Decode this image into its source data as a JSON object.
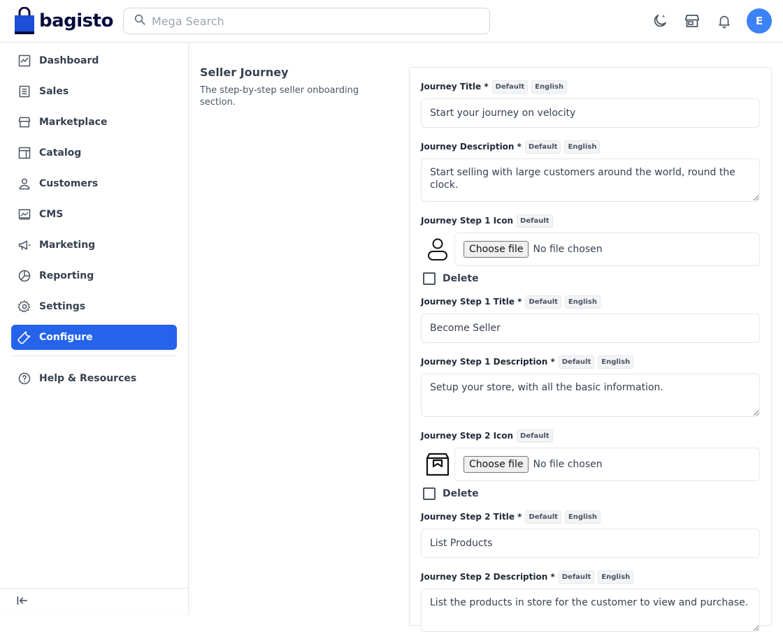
{
  "brand": {
    "name": "bagisto",
    "color": "#060C3B",
    "bag_color": "#1D4ED8"
  },
  "header": {
    "search_placeholder": "Mega Search",
    "avatar_initial": "E",
    "icons": [
      "moon-icon",
      "store-icon",
      "bell-icon"
    ]
  },
  "sidebar": {
    "items": [
      {
        "label": "Dashboard",
        "icon": "dashboard-icon"
      },
      {
        "label": "Sales",
        "icon": "receipt-icon"
      },
      {
        "label": "Marketplace",
        "icon": "store-icon"
      },
      {
        "label": "Catalog",
        "icon": "catalog-icon"
      },
      {
        "label": "Customers",
        "icon": "user-icon"
      },
      {
        "label": "CMS",
        "icon": "cms-icon"
      },
      {
        "label": "Marketing",
        "icon": "megaphone-icon"
      },
      {
        "label": "Reporting",
        "icon": "pie-chart-icon"
      },
      {
        "label": "Settings",
        "icon": "gear-icon"
      },
      {
        "label": "Configure",
        "icon": "wrench-icon",
        "active": true
      }
    ],
    "help": {
      "label": "Help & Resources",
      "icon": "help-icon"
    },
    "accent": "#2563EB"
  },
  "section": {
    "title": "Seller Journey",
    "description": "The step-by-step seller onboarding section."
  },
  "badges": {
    "default": "Default",
    "english": "English"
  },
  "form": {
    "journey_title": {
      "label": "Journey Title *",
      "value": "Start your journey on velocity"
    },
    "journey_description": {
      "label": "Journey Description *",
      "value": "Start selling with large customers around the world, round the clock."
    },
    "step1_icon": {
      "label": "Journey Step 1 Icon",
      "choose": "Choose file",
      "status": "No file chosen",
      "delete_label": "Delete"
    },
    "step1_title": {
      "label": "Journey Step 1 Title *",
      "value": "Become Seller"
    },
    "step1_description": {
      "label": "Journey Step 1 Description *",
      "value": "Setup your store, with all the basic information."
    },
    "step2_icon": {
      "label": "Journey Step 2 Icon",
      "choose": "Choose file",
      "status": "No file chosen",
      "delete_label": "Delete"
    },
    "step2_title": {
      "label": "Journey Step 2 Title *",
      "value": "List Products"
    },
    "step2_description": {
      "label": "Journey Step 2 Description *",
      "value": "List the products in store for the customer to view and purchase."
    }
  }
}
